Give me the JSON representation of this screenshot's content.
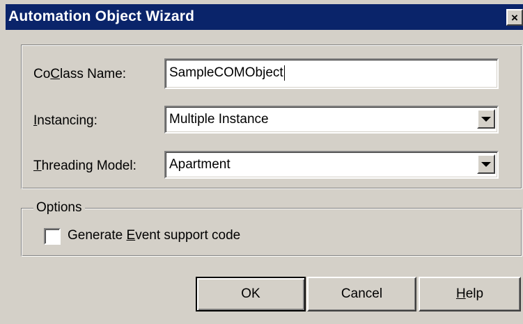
{
  "window": {
    "title": "Automation Object Wizard",
    "close_glyph": "×"
  },
  "fields": {
    "coclass": {
      "label_pre": "Co",
      "label_key": "C",
      "label_post": "lass Name:",
      "value": "SampleCOMObject"
    },
    "instancing": {
      "label_pre": "",
      "label_key": "I",
      "label_post": "nstancing:",
      "value": "Multiple Instance"
    },
    "threading": {
      "label_pre": "",
      "label_key": "T",
      "label_post": "hreading Model:",
      "value": "Apartment"
    }
  },
  "options": {
    "legend": "Options",
    "event_support": {
      "label_pre": "Generate ",
      "label_key": "E",
      "label_post": "vent support code",
      "checked": false
    }
  },
  "buttons": {
    "ok": "OK",
    "cancel": "Cancel",
    "help_key": "H",
    "help_rest": "elp"
  },
  "icons": {
    "close": "close-icon",
    "dropdown": "chevron-down-icon"
  },
  "colors": {
    "titlebar": "#0a246a",
    "face": "#d4d0c8"
  }
}
